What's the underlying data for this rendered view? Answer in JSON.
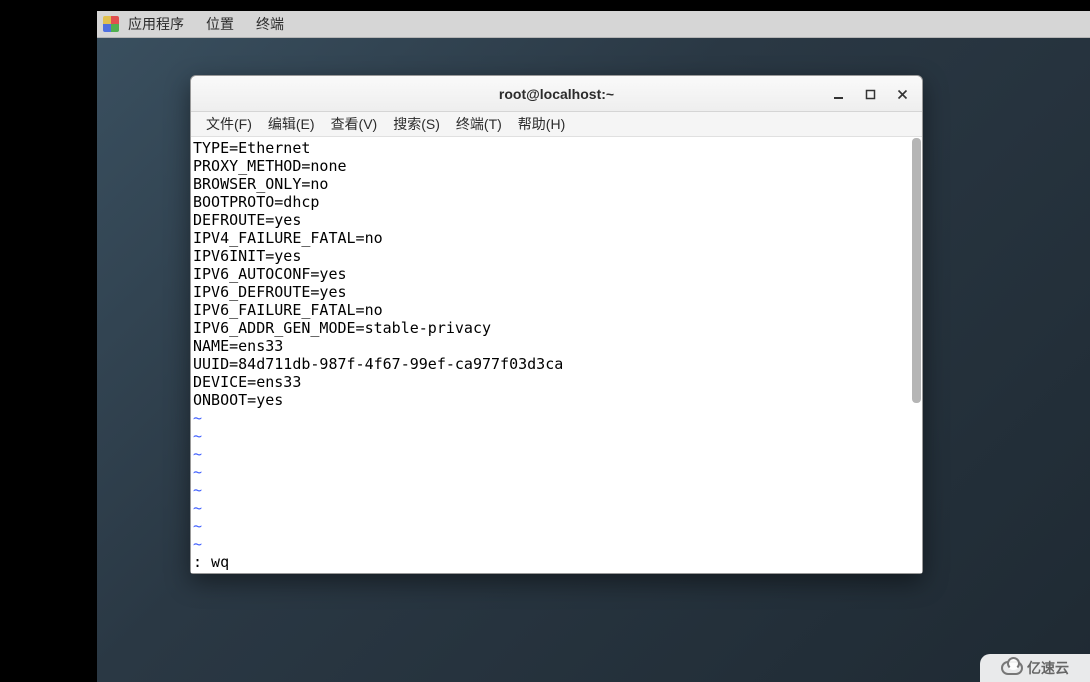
{
  "panel": {
    "apps": "应用程序",
    "places": "位置",
    "terminal": "终端"
  },
  "window": {
    "title": "root@localhost:~"
  },
  "menus": {
    "file": "文件(F)",
    "edit": "编辑(E)",
    "view": "查看(V)",
    "search": "搜索(S)",
    "terminal": "终端(T)",
    "help": "帮助(H)"
  },
  "editor": {
    "lines": [
      "TYPE=Ethernet",
      "PROXY_METHOD=none",
      "BROWSER_ONLY=no",
      "BOOTPROTO=dhcp",
      "DEFROUTE=yes",
      "IPV4_FAILURE_FATAL=no",
      "IPV6INIT=yes",
      "IPV6_AUTOCONF=yes",
      "IPV6_DEFROUTE=yes",
      "IPV6_FAILURE_FATAL=no",
      "IPV6_ADDR_GEN_MODE=stable-privacy",
      "NAME=ens33",
      "UUID=84d711db-987f-4f67-99ef-ca977f03d3ca",
      "DEVICE=ens33",
      "ONBOOT=yes"
    ],
    "tilde": "~",
    "tilde_count": 8,
    "cmdline": ": wq"
  },
  "watermark": {
    "text": "亿速云"
  }
}
